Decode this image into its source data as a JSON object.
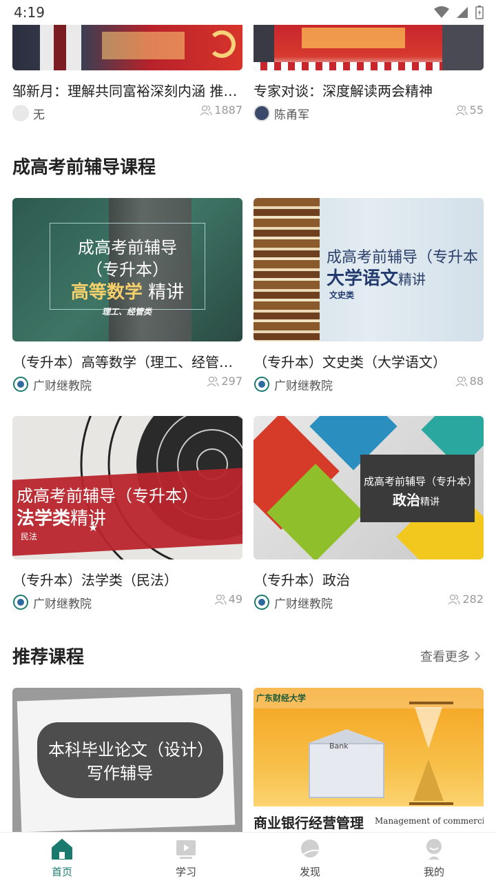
{
  "status_bar": {
    "time": "4:19"
  },
  "top_cards": [
    {
      "title": "邹新月：理解共同富裕深刻内涵 推…",
      "author": "无",
      "count": "1887"
    },
    {
      "title": "专家对谈：深度解读两会精神",
      "author": "陈甬军",
      "count": "55"
    }
  ],
  "section_exam": {
    "title": "成高考前辅导课程",
    "courses": [
      {
        "title": "（专升本）高等数学（理工、经管…",
        "author": "广财继教院",
        "count": "297",
        "thumb": {
          "line1": "成高考前辅导",
          "line2": "（专升本）",
          "line3a": "高等数学",
          "line3b": " 精讲",
          "line4": "理工、经管类"
        }
      },
      {
        "title": "（专升本）文史类（大学语文）",
        "author": "广财继教院",
        "count": "88",
        "thumb": {
          "line1": "成高考前辅导（专升本",
          "line2a": "大学语文",
          "line2b": "精讲",
          "line3": "文史类"
        }
      },
      {
        "title": "（专升本）法学类（民法）",
        "author": "广财继教院",
        "count": "49",
        "thumb": {
          "line1": "成高考前辅导（专升本）",
          "line2a": "法学类",
          "line2b": "精讲",
          "line3": "民法"
        }
      },
      {
        "title": "（专升本）政治",
        "author": "广财继教院",
        "count": "282",
        "thumb": {
          "line1": "成高考前辅导（专升本）",
          "line2a": "政治",
          "line2b": "精讲"
        }
      }
    ]
  },
  "section_recommend": {
    "title": "推荐课程",
    "see_more": "查看更多",
    "courses": [
      {
        "thumb": {
          "line1": "本科毕业论文（设计）",
          "line2": "写作辅导"
        }
      },
      {
        "thumb": {
          "line1": "商业银行经营管理",
          "line2": "Management of commercial ban",
          "bank": "Bank",
          "school": "广东财经大学"
        }
      }
    ]
  },
  "tabbar": {
    "items": [
      {
        "label": "首页",
        "active": true
      },
      {
        "label": "学习",
        "active": false
      },
      {
        "label": "发现",
        "active": false
      },
      {
        "label": "我的",
        "active": false
      }
    ]
  },
  "colors": {
    "accent": "#1a7a6e",
    "muted": "#999999"
  }
}
